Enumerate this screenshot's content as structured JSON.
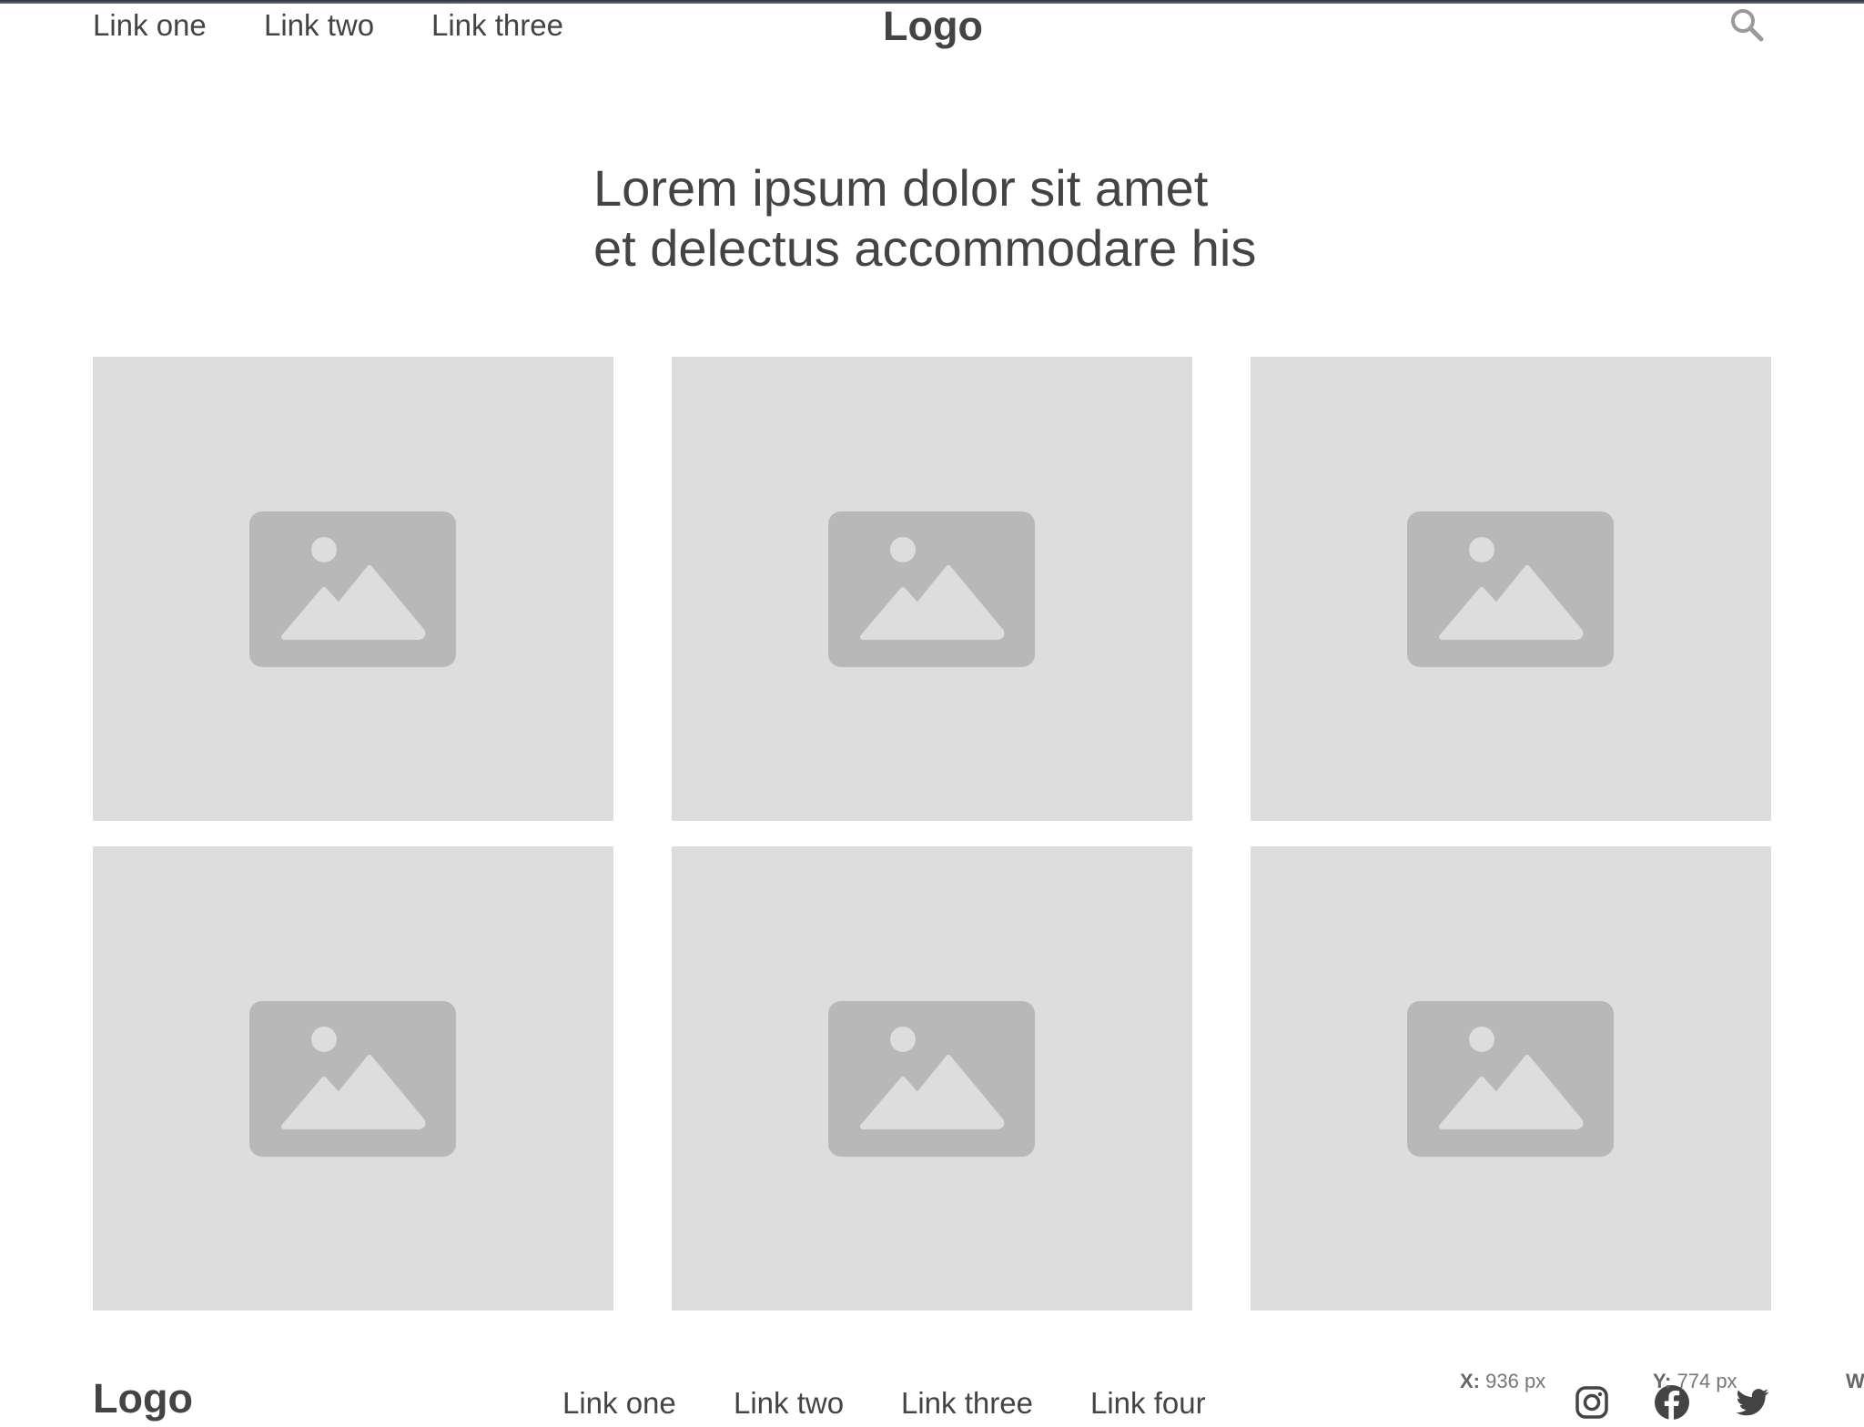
{
  "header": {
    "nav": [
      "Link one",
      "Link two",
      "Link three"
    ],
    "logo": "Logo",
    "search_icon": "search-icon"
  },
  "hero": {
    "line1": "Lorem ipsum dolor sit amet",
    "line2": "et delectus accommodare his"
  },
  "gallery": {
    "tile_count": 6,
    "tile_icon": "image-placeholder-icon",
    "colors": {
      "tile_bg": "#dddddd",
      "icon": "#b8b8b8"
    }
  },
  "footer": {
    "logo": "Logo",
    "nav": [
      "Link one",
      "Link two",
      "Link three",
      "Link four"
    ],
    "social_icons": [
      "instagram-icon",
      "facebook-icon",
      "twitter-icon"
    ]
  },
  "cursor_readout": {
    "x_label": "X:",
    "x_value": "936 px",
    "y_label": "Y:",
    "y_value": "774 px",
    "w_label": "W"
  },
  "colors": {
    "text": "#444444",
    "muted": "#777777"
  }
}
